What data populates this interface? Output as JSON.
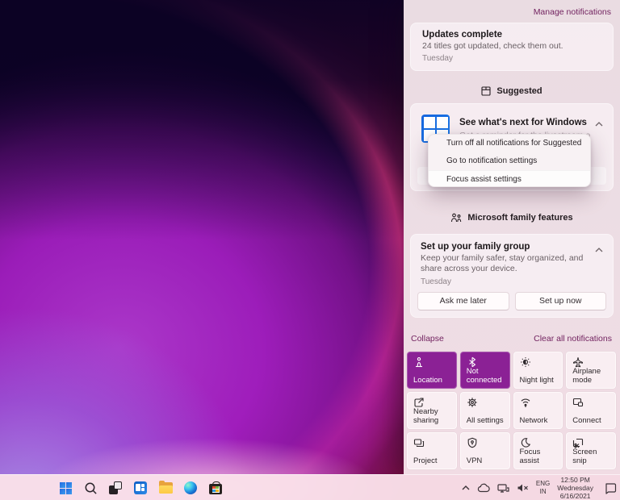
{
  "colors": {
    "accent_purple": "#8b2195",
    "link_text": "#722360",
    "panel_background": "#ecdde3",
    "taskbar_background": "#fae0e9",
    "start_blue": "#2e7ce4"
  },
  "panel": {
    "manage_link": "Manage notifications",
    "updates_card": {
      "title": "Updates complete",
      "body": "24 titles got updated, check them out.",
      "time": "Tuesday"
    },
    "suggested_section": {
      "label": "Suggested",
      "icon": "app-window-icon"
    },
    "whats_next_card": {
      "title": "See what's next for Windows",
      "body": "Get a reminder for the livestream on",
      "app_icon": "windows-logo-icon"
    },
    "context_menu": {
      "items": [
        {
          "label": "Turn off all notifications for Suggested"
        },
        {
          "label": "Go to notification settings"
        },
        {
          "label": "Focus assist settings"
        }
      ]
    },
    "family_section": {
      "label": "Microsoft family features",
      "icon": "family-icon"
    },
    "family_card": {
      "title": "Set up your family group",
      "body": "Keep your family safer, stay organized, and share across your device.",
      "time": "Tuesday",
      "ask_later_button": "Ask me later",
      "set_up_button": "Set up now"
    },
    "collapse_link": "Collapse",
    "clear_link": "Clear all notifications"
  },
  "quick_settings": {
    "tiles": [
      {
        "label": "Location",
        "icon": "location-icon",
        "active": true
      },
      {
        "label": "Not connected",
        "icon": "bluetooth-icon",
        "active": true
      },
      {
        "label": "Night light",
        "icon": "night-light-icon",
        "active": false
      },
      {
        "label": "Airplane mode",
        "icon": "airplane-icon",
        "active": false
      },
      {
        "label": "Nearby sharing",
        "icon": "nearby-sharing-icon",
        "active": false
      },
      {
        "label": "All settings",
        "icon": "settings-gear-icon",
        "active": false
      },
      {
        "label": "Network",
        "icon": "network-icon",
        "active": false
      },
      {
        "label": "Connect",
        "icon": "connect-icon",
        "active": false
      },
      {
        "label": "Project",
        "icon": "project-icon",
        "active": false
      },
      {
        "label": "VPN",
        "icon": "vpn-shield-icon",
        "active": false
      },
      {
        "label": "Focus assist",
        "icon": "focus-assist-icon",
        "active": false
      },
      {
        "label": "Screen snip",
        "icon": "screen-snip-icon",
        "active": false
      }
    ]
  },
  "taskbar": {
    "app_icons": [
      "start-icon",
      "search-icon",
      "task-view-icon",
      "widgets-icon",
      "file-explorer-icon",
      "edge-icon",
      "microsoft-store-icon"
    ],
    "tray_icons": [
      "chevron-up-icon",
      "onedrive-cloud-icon",
      "ethernet-icon",
      "volume-muted-icon"
    ],
    "language": {
      "line1": "ENG",
      "line2": "IN"
    },
    "clock": {
      "time": "12:50 PM",
      "day": "Wednesday",
      "date": "6/16/2021"
    },
    "notification_icon": "notification-bubble-icon"
  }
}
